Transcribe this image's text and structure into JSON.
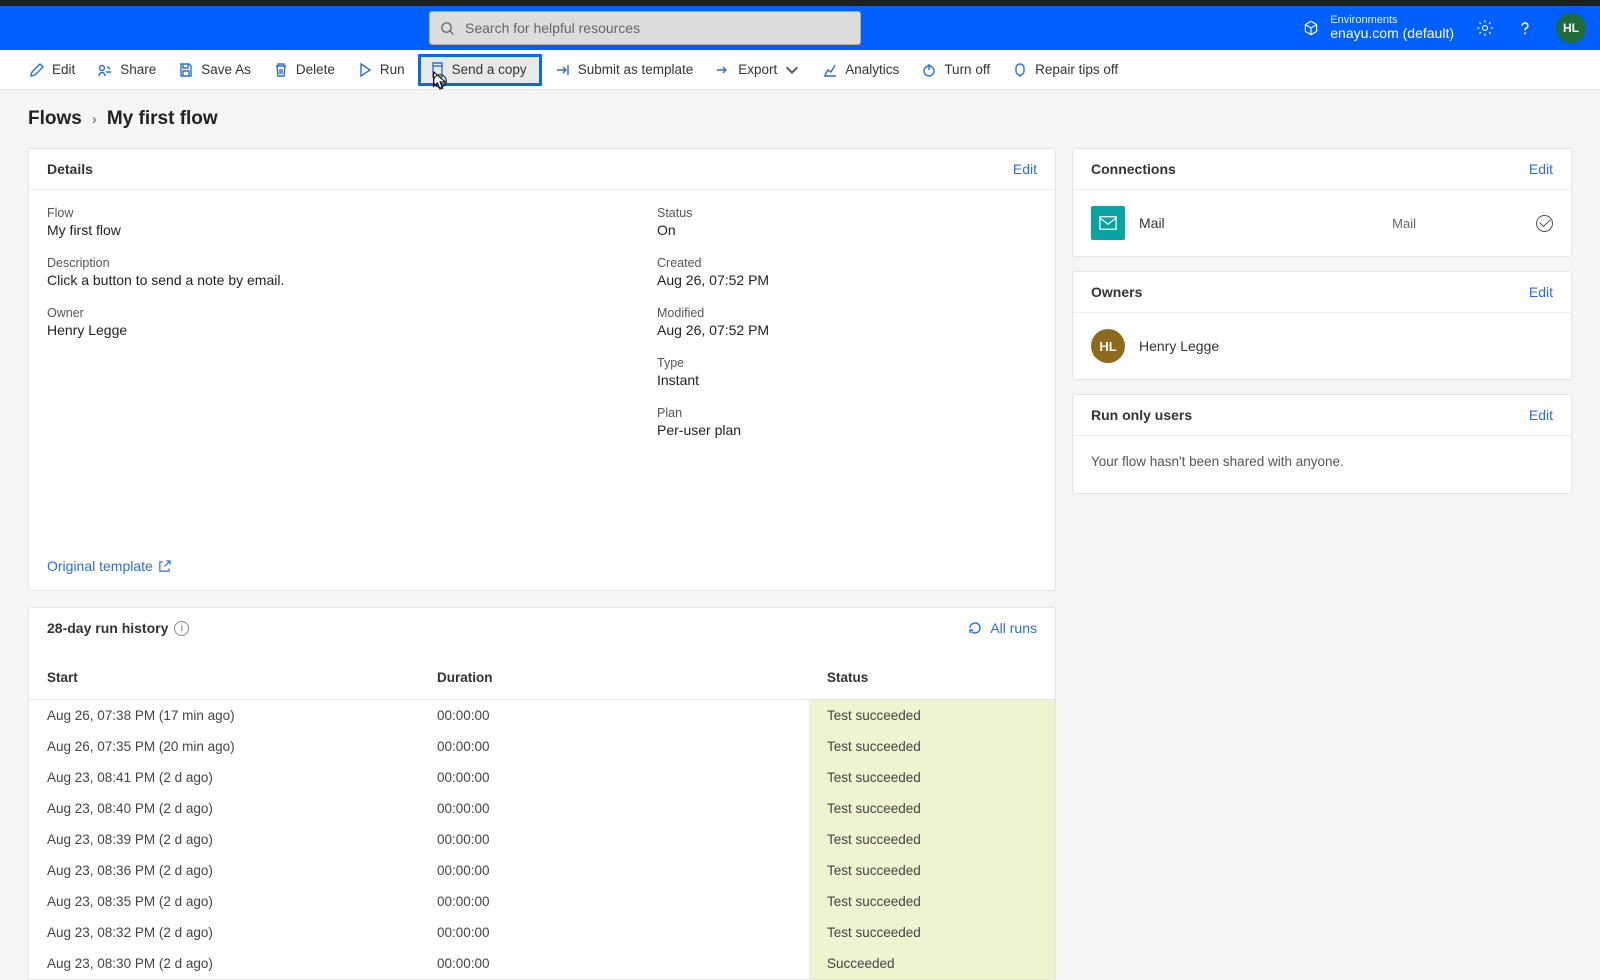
{
  "header": {
    "search_placeholder": "Search for helpful resources",
    "env_label": "Environments",
    "env_name": "enayu.com (default)",
    "avatar_initials": "HL"
  },
  "commandbar": {
    "edit": "Edit",
    "share": "Share",
    "saveas": "Save As",
    "delete": "Delete",
    "run": "Run",
    "sendcopy": "Send a copy",
    "submit": "Submit as template",
    "export": "Export",
    "analytics": "Analytics",
    "turnoff": "Turn off",
    "repair": "Repair tips off"
  },
  "breadcrumb": {
    "root": "Flows",
    "current": "My first flow"
  },
  "details": {
    "title": "Details",
    "edit": "Edit",
    "flow_label": "Flow",
    "flow_value": "My first flow",
    "status_label": "Status",
    "status_value": "On",
    "desc_label": "Description",
    "desc_value": "Click a button to send a note by email.",
    "created_label": "Created",
    "created_value": "Aug 26, 07:52 PM",
    "owner_label": "Owner",
    "owner_value": "Henry Legge",
    "modified_label": "Modified",
    "modified_value": "Aug 26, 07:52 PM",
    "type_label": "Type",
    "type_value": "Instant",
    "plan_label": "Plan",
    "plan_value": "Per-user plan",
    "orig_template": "Original template"
  },
  "history": {
    "title": "28-day run history",
    "allruns": "All runs",
    "col_start": "Start",
    "col_duration": "Duration",
    "col_status": "Status",
    "rows": [
      {
        "start": "Aug 26, 07:38 PM (17 min ago)",
        "duration": "00:00:00",
        "status": "Test succeeded"
      },
      {
        "start": "Aug 26, 07:35 PM (20 min ago)",
        "duration": "00:00:00",
        "status": "Test succeeded"
      },
      {
        "start": "Aug 23, 08:41 PM (2 d ago)",
        "duration": "00:00:00",
        "status": "Test succeeded"
      },
      {
        "start": "Aug 23, 08:40 PM (2 d ago)",
        "duration": "00:00:00",
        "status": "Test succeeded"
      },
      {
        "start": "Aug 23, 08:39 PM (2 d ago)",
        "duration": "00:00:00",
        "status": "Test succeeded"
      },
      {
        "start": "Aug 23, 08:36 PM (2 d ago)",
        "duration": "00:00:00",
        "status": "Test succeeded"
      },
      {
        "start": "Aug 23, 08:35 PM (2 d ago)",
        "duration": "00:00:00",
        "status": "Test succeeded"
      },
      {
        "start": "Aug 23, 08:32 PM (2 d ago)",
        "duration": "00:00:00",
        "status": "Test succeeded"
      },
      {
        "start": "Aug 23, 08:30 PM (2 d ago)",
        "duration": "00:00:00",
        "status": "Succeeded"
      }
    ]
  },
  "connections": {
    "title": "Connections",
    "edit": "Edit",
    "item_name": "Mail",
    "item_type": "Mail"
  },
  "owners": {
    "title": "Owners",
    "edit": "Edit",
    "avatar": "HL",
    "name": "Henry Legge"
  },
  "runonly": {
    "title": "Run only users",
    "edit": "Edit",
    "body": "Your flow hasn't been shared with anyone."
  }
}
